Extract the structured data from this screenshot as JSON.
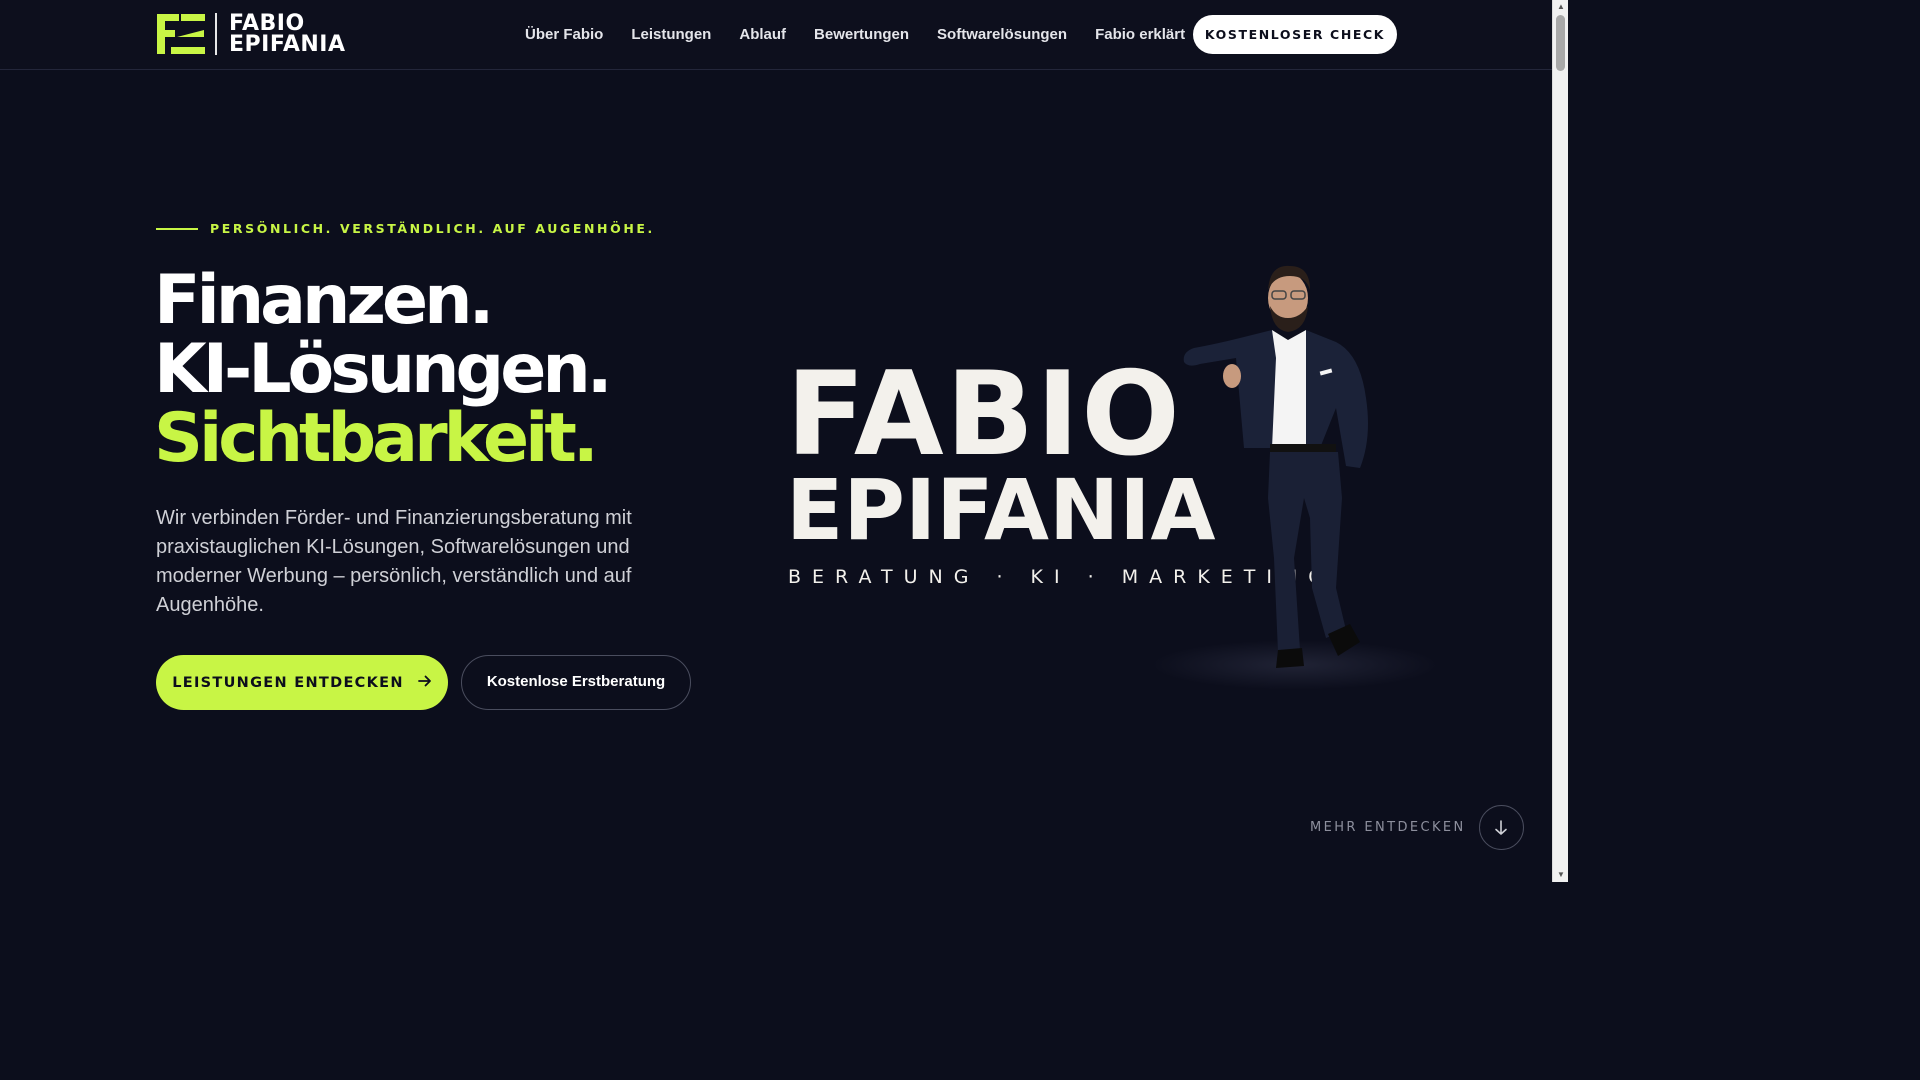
{
  "header": {
    "logo": {
      "line1": "FABIO",
      "line2": "EPIFANIA",
      "mark_color": "#c8f545"
    },
    "nav": [
      {
        "label": "Über Fabio"
      },
      {
        "label": "Leistungen"
      },
      {
        "label": "Ablauf"
      },
      {
        "label": "Bewertungen"
      },
      {
        "label": "Softwarelösungen"
      },
      {
        "label": "Fabio erklärt"
      }
    ],
    "cta_label": "KOSTENLOSER CHECK"
  },
  "hero": {
    "eyebrow": "PERSÖNLICH. VERSTÄNDLICH. AUF AUGENHÖHE.",
    "headline": [
      "Finanzen.",
      "KI-Lösungen.",
      "Sichtbarkeit."
    ],
    "subtext": "Wir verbinden Förder- und Finanzierungsberatung mit praxistauglichen KI-Lösungen, Softwarelösungen und moderner Werbung – persönlich, verständlich und auf Augenhöhe.",
    "primary_button": "LEISTUNGEN ENTDECKEN",
    "secondary_button": "Kostenlose Erstberatung",
    "brand": {
      "line1": "FABIO",
      "line2": "EPIFANIA",
      "tagline": "BERATUNG · KI · MARKETING"
    },
    "more_label": "MEHR ENTDECKEN"
  },
  "colors": {
    "accent": "#c8f545",
    "background": "#0c0e1c",
    "text": "#ffffff"
  }
}
